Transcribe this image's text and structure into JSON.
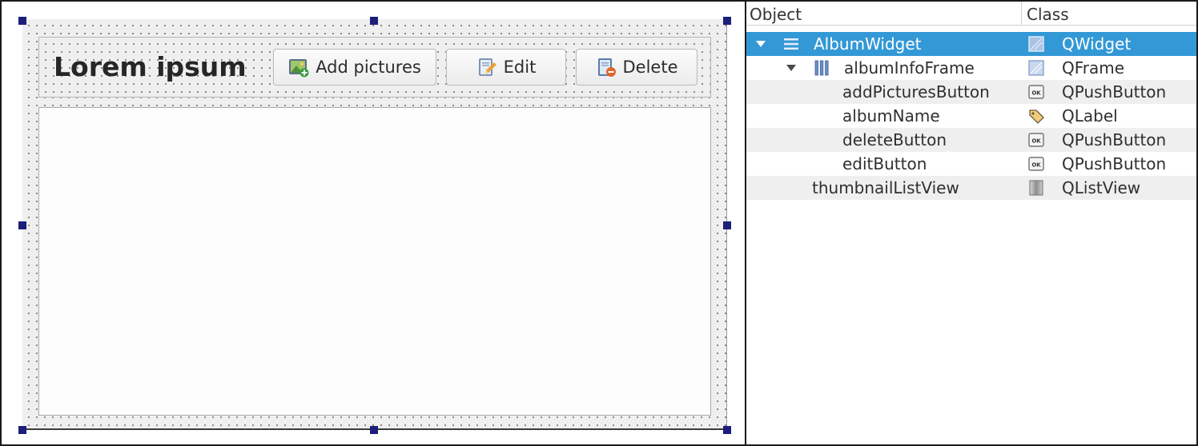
{
  "form": {
    "album_name": "Lorem ipsum",
    "add_pictures_label": "Add pictures",
    "edit_label": "Edit",
    "delete_label": "Delete"
  },
  "inspector": {
    "header": {
      "object": "Object",
      "class": "Class"
    },
    "rows": [
      {
        "object": "AlbumWidget",
        "class": "QWidget",
        "object_icon": "layout-vertical-icon",
        "class_icon": "widget-icon",
        "expanded": true,
        "selected": true
      },
      {
        "object": "albumInfoFrame",
        "class": "QFrame",
        "object_icon": "layout-horizontal-icon",
        "class_icon": "frame-icon",
        "expanded": true
      },
      {
        "object": "addPicturesButton",
        "class": "QPushButton",
        "class_icon": "push-button-icon"
      },
      {
        "object": "albumName",
        "class": "QLabel",
        "class_icon": "label-tag-icon"
      },
      {
        "object": "deleteButton",
        "class": "QPushButton",
        "class_icon": "push-button-icon"
      },
      {
        "object": "editButton",
        "class": "QPushButton",
        "class_icon": "push-button-icon"
      },
      {
        "object": "thumbnailListView",
        "class": "QListView",
        "class_icon": "list-view-icon"
      }
    ]
  },
  "colors": {
    "selection": "#3398d6",
    "handle": "#1b1f7a",
    "alternate_row": "#efefef"
  }
}
